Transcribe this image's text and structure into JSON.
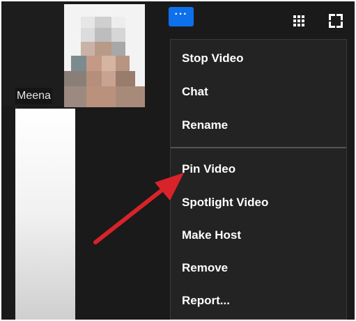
{
  "participant": {
    "name": "Meena"
  },
  "toolbar": {
    "more_label": "···"
  },
  "menu": {
    "items_top": [
      "Stop Video",
      "Chat",
      "Rename"
    ],
    "items_bottom": [
      "Pin Video",
      "Spotlight Video",
      "Make Host",
      "Remove",
      "Report..."
    ]
  },
  "icons": {
    "more": "more-options-icon",
    "grid": "gallery-grid-icon",
    "fullscreen": "fullscreen-icon",
    "arrow": "red-arrow-icon"
  },
  "colors": {
    "accent": "#0e71eb",
    "menu_bg": "#232323",
    "arrow": "#d8232a"
  }
}
